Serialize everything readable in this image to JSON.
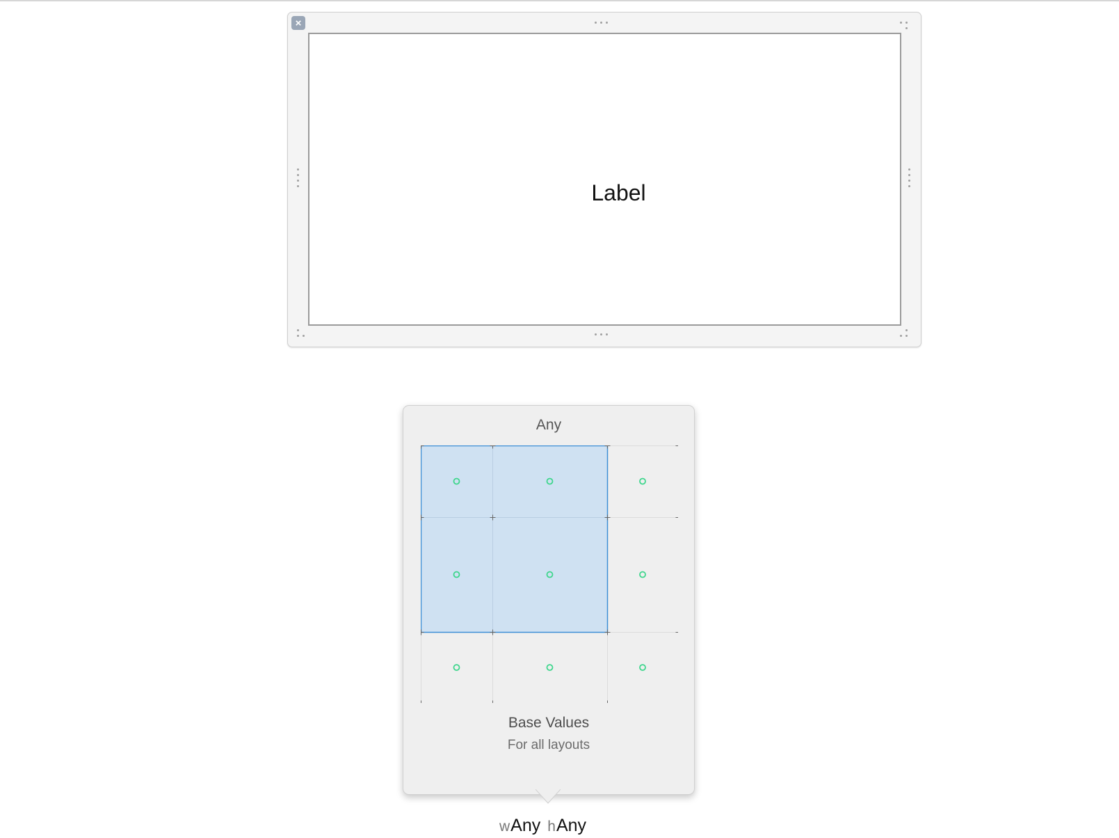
{
  "scene": {
    "close_glyph": "×",
    "label": "Label"
  },
  "size_class_popover": {
    "title": "Any",
    "grid": {
      "rows": 3,
      "cols": 3,
      "selected_rows": 2,
      "selected_cols": 2,
      "selection_color": "#cfe1f2",
      "selection_border": "#3d8fd6",
      "dot_color": "#3dd68c"
    },
    "base_title": "Base Values",
    "base_subtitle": "For all layouts"
  },
  "size_class_bar": {
    "width_prefix": "w",
    "width_value": "Any",
    "height_prefix": "h",
    "height_value": "Any"
  }
}
